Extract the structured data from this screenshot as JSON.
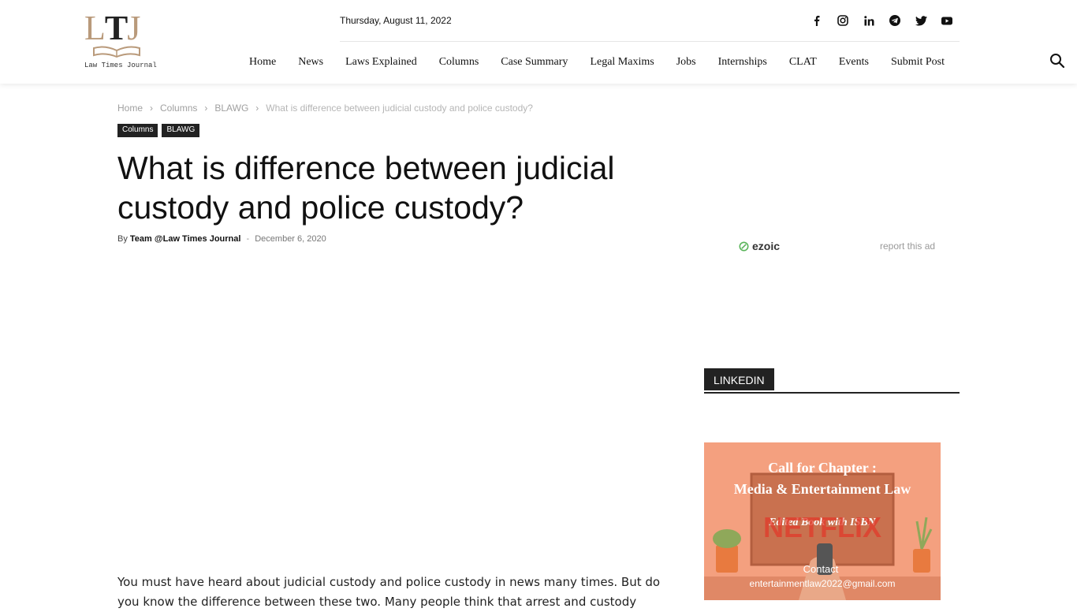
{
  "site": {
    "logo_text": "LTJ",
    "logo_sub": "Law Times Journal"
  },
  "header": {
    "date": "Thursday, August 11, 2022",
    "social_icons": [
      "facebook-icon",
      "instagram-icon",
      "linkedin-icon",
      "telegram-icon",
      "twitter-icon",
      "youtube-icon"
    ],
    "nav": [
      "Home",
      "News",
      "Laws Explained",
      "Columns",
      "Case Summary",
      "Legal Maxims",
      "Jobs",
      "Internships",
      "CLAT",
      "Events",
      "Submit Post"
    ]
  },
  "breadcrumb": {
    "home": "Home",
    "columns": "Columns",
    "blawg": "BLAWG",
    "current": "What is difference between judicial custody and police custody?",
    "separator": "›"
  },
  "tags": [
    "Columns",
    "BLAWG"
  ],
  "article": {
    "title": "What is difference between judicial custody and police custody?",
    "by": "By",
    "author": "Team @Law Times Journal",
    "dash": "-",
    "date": "December 6, 2020",
    "body": "You must have heard about judicial custody and police custody in news many times. But do you know the difference between these two. Many people think that arrest and custody"
  },
  "sidebar": {
    "ad_brand": "ezoic",
    "report_ad": "report this ad",
    "linkedin_label": "LINKEDIN",
    "promo": {
      "line1": "Call for Chapter :",
      "line2": "Media & Entertainment Law",
      "line3": "Edited Book with ISBN",
      "brand_on_tv": "NETFLIX",
      "contact_label": "Contact",
      "contact_email": "entertainmentlaw2022@gmail.com"
    }
  },
  "colors": {
    "accent_dark": "#222222",
    "logo_gold": "#b99a7b",
    "promo_bg": "#f4a07f",
    "netflix_red": "#e23a2a"
  }
}
